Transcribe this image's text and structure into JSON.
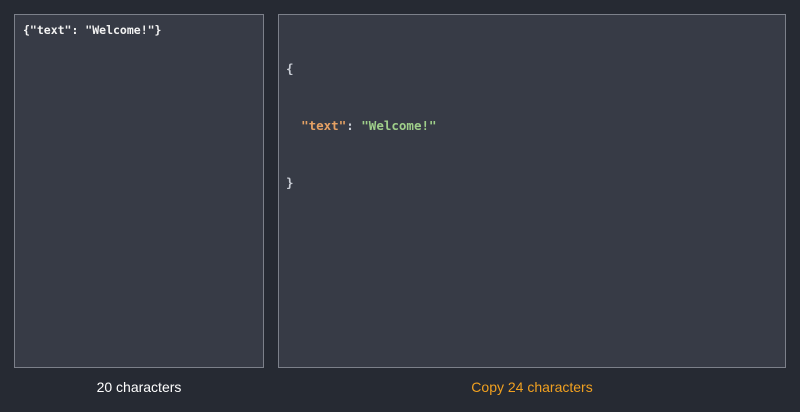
{
  "input_panel": {
    "text": "{\"text\": \"Welcome!\"}",
    "char_count_label": "20 characters"
  },
  "output_panel": {
    "open_brace": "{",
    "indent": "  ",
    "key": "\"text\"",
    "colon": ": ",
    "value": "\"Welcome!\"",
    "close_brace": "}",
    "copy_label": "Copy 24 characters"
  },
  "colors": {
    "background": "#262a33",
    "panel": "#373b46",
    "panel_border": "#7c808a",
    "key": "#e5a164",
    "string": "#9fcf8a",
    "copy_accent": "#f0a020"
  }
}
